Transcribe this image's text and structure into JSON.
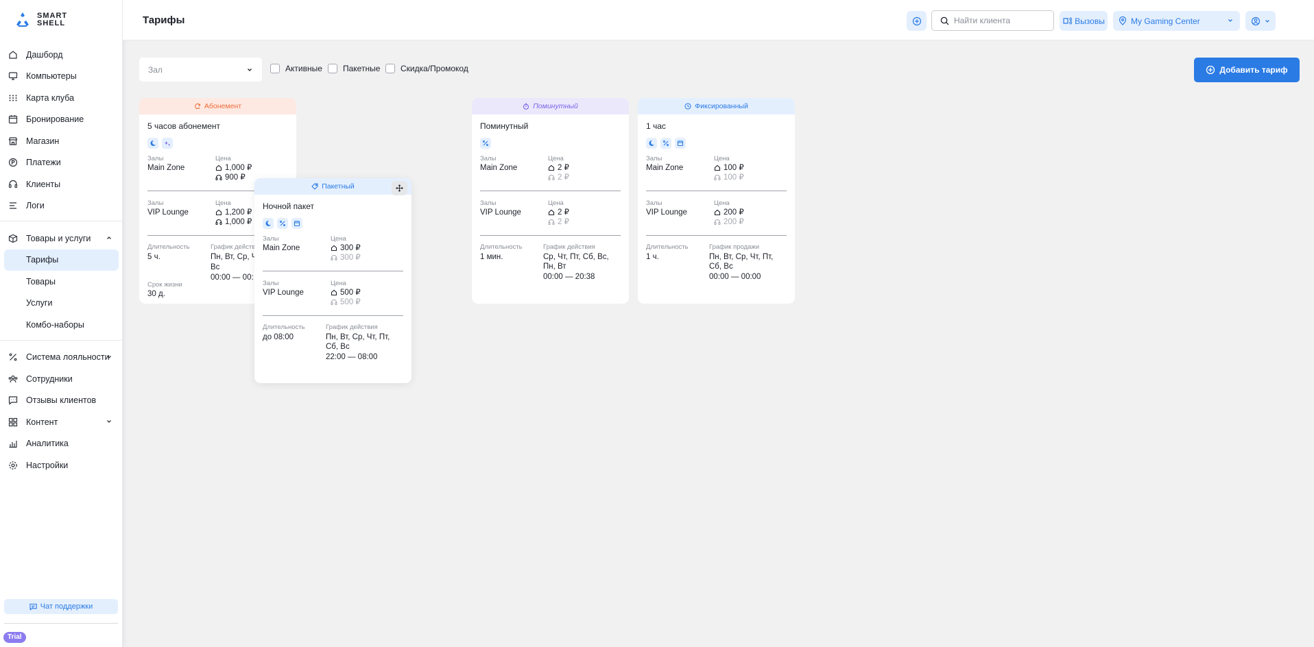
{
  "brand": {
    "line1": "SMART",
    "line2": "SHELL"
  },
  "header": {
    "title": "Тарифы",
    "search_placeholder": "Найти клиента",
    "calls_label": "Вызовы",
    "club_name": "My Gaming Center"
  },
  "sidebar": {
    "items": [
      {
        "label": "Дашборд",
        "icon": "home-icon"
      },
      {
        "label": "Компьютеры",
        "icon": "monitor-icon"
      },
      {
        "label": "Карта клуба",
        "icon": "grid-dots-icon"
      },
      {
        "label": "Бронирование",
        "icon": "calendar-icon"
      },
      {
        "label": "Магазин",
        "icon": "store-icon"
      },
      {
        "label": "Платежи",
        "icon": "coin-icon"
      },
      {
        "label": "Клиенты",
        "icon": "headset-icon"
      },
      {
        "label": "Логи",
        "icon": "list-icon"
      }
    ],
    "goods_group": {
      "label": "Товары и услуги",
      "icon": "box-icon"
    },
    "goods_sub": [
      "Тарифы",
      "Товары",
      "Услуги",
      "Комбо-наборы"
    ],
    "items2": [
      {
        "label": "Система лояльности",
        "icon": "percent-icon",
        "expandable": true
      },
      {
        "label": "Сотрудники",
        "icon": "users-icon"
      },
      {
        "label": "Отзывы клиентов",
        "icon": "chat-icon"
      },
      {
        "label": "Контент",
        "icon": "apps-icon",
        "expandable": true
      },
      {
        "label": "Аналитика",
        "icon": "chart-icon"
      },
      {
        "label": "Настройки",
        "icon": "settings-icon"
      }
    ],
    "support_label": "Чат поддержки",
    "trial_label": "Trial"
  },
  "toolbar": {
    "hall_placeholder": "Зал",
    "filters": [
      "Активные",
      "Пакетные",
      "Скидка/Промокод"
    ],
    "add_label": "Добавить тариф"
  },
  "labels": {
    "zones": "Залы",
    "price": "Цена",
    "duration": "Длительность",
    "schedule_action": "График действия",
    "schedule_sale": "График продажи",
    "lifetime": "Срок жизни"
  },
  "cards": {
    "subscription": {
      "type": "Абонемент",
      "name": "5 часов абонемент",
      "zones": [
        {
          "name": "Main Zone",
          "price1": "1,000 ₽",
          "price2": "900 ₽"
        },
        {
          "name": "VIP Lounge",
          "price1": "1,200 ₽",
          "price2": "1,000 ₽"
        }
      ],
      "duration": "5 ч.",
      "schedule_days": "Пн, Вт, Ср, Чт,",
      "schedule_days2": "Вс",
      "schedule_time": "00:00 — 00:",
      "lifetime": "30 д."
    },
    "package": {
      "type": "Пакетный",
      "name": "Ночной пакет",
      "zones": [
        {
          "name": "Main Zone",
          "price1": "300 ₽",
          "price2": "300 ₽"
        },
        {
          "name": "VIP Lounge",
          "price1": "500 ₽",
          "price2": "500 ₽"
        }
      ],
      "duration": "до 08:00",
      "schedule_days": "Пн, Вт, Ср, Чт, Пт, Сб, Вс",
      "schedule_time": "22:00 — 08:00"
    },
    "per_minute": {
      "type": "Поминутный",
      "name": "Поминутный",
      "zones": [
        {
          "name": "Main Zone",
          "price1": "2 ₽",
          "price2": "2 ₽"
        },
        {
          "name": "VIP Lounge",
          "price1": "2 ₽",
          "price2": "2 ₽"
        }
      ],
      "duration": "1 мин.",
      "schedule_days": "Ср, Чт, Пт, Сб, Вс, Пн, Вт",
      "schedule_time": "00:00 — 20:38"
    },
    "fixed": {
      "type": "Фиксированный",
      "name": "1 час",
      "zones": [
        {
          "name": "Main Zone",
          "price1": "100 ₽",
          "price2": "100 ₽"
        },
        {
          "name": "VIP Lounge",
          "price1": "200 ₽",
          "price2": "200 ₽"
        }
      ],
      "duration": "1 ч.",
      "schedule_days": "Пн, Вт, Ср, Чт, Пт, Сб, Вс",
      "schedule_time": "00:00 — 00:00"
    }
  },
  "colors": {
    "accent": "#2a7be4",
    "accent_light": "#e4effe",
    "subscription": "#ef6c3a",
    "per_minute": "#7a62e6",
    "trial": "#8b7cf0"
  }
}
